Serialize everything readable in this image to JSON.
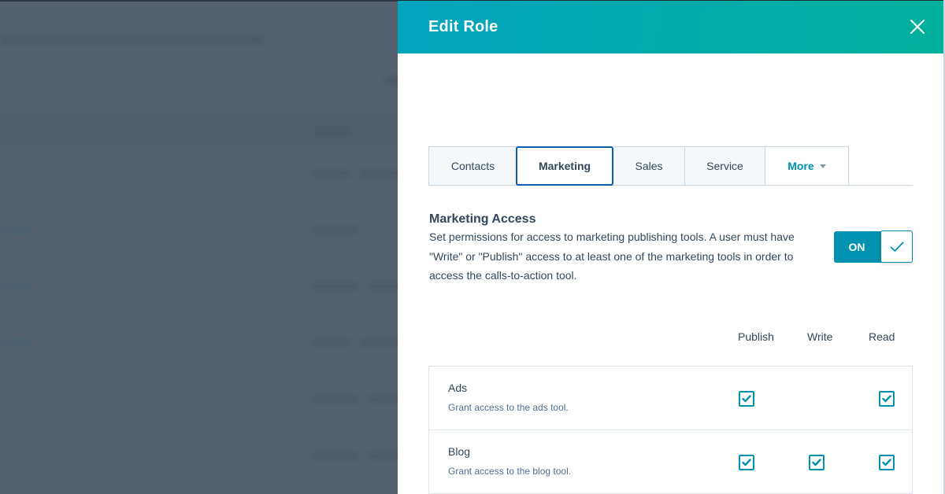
{
  "panel": {
    "title": "Edit Role",
    "close_icon": "close-icon"
  },
  "tabs": [
    {
      "label": "Contacts",
      "active": false
    },
    {
      "label": "Marketing",
      "active": true
    },
    {
      "label": "Sales",
      "active": false
    },
    {
      "label": "Service",
      "active": false
    },
    {
      "label": "More",
      "active": false,
      "dropdown": true
    }
  ],
  "section": {
    "title": "Marketing Access",
    "description": "Set permissions for access to marketing publishing tools. A user must have \"Write\" or \"Publish\" access to at least one of the marketing tools in order to access the calls-to-action tool.",
    "toggle": {
      "label": "ON",
      "state": true,
      "icon": "checkmark-icon"
    }
  },
  "permissions": {
    "columns": [
      "Publish",
      "Write",
      "Read"
    ],
    "rows": [
      {
        "name": "Ads",
        "description": "Grant access to the ads tool.",
        "publish": true,
        "write": null,
        "read": true
      },
      {
        "name": "Blog",
        "description": "Grant access to the blog tool.",
        "publish": true,
        "write": true,
        "read": true
      }
    ]
  },
  "colors": {
    "header_gradient_start": "#00a4bd",
    "header_gradient_end": "#00b09b",
    "accent": "#0091ae",
    "active_tab_border": "#0b5cad",
    "text": "#33475b",
    "overlay": "#55616e"
  }
}
